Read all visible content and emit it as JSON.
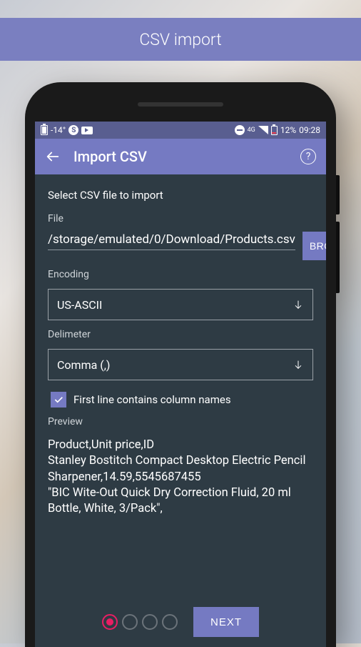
{
  "banner": {
    "title": "CSV import"
  },
  "status": {
    "temp": "-14°",
    "net_label": "4G",
    "battery_pct": "12%",
    "time": "09:28"
  },
  "appbar": {
    "title": "Import CSV"
  },
  "form": {
    "header": "Select CSV file to import",
    "file_label": "File",
    "file_path": "/storage/emulated/0/Download/Products.csv",
    "browse_label": "BROWSE...",
    "encoding_label": "Encoding",
    "encoding_value": "US-ASCII",
    "delimiter_label": "Delimeter",
    "delimiter_value": "Comma (,)",
    "firstline_label": "First line contains column names",
    "firstline_checked": true,
    "preview_label": "Preview",
    "preview_text": "Product,Unit price,ID\nStanley Bostitch Compact Desktop Electric Pencil Sharpener,14.59,5545687455\n\"BIC Wite-Out Quick Dry Correction Fluid, 20 ml Bottle, White, 3/Pack\","
  },
  "footer": {
    "page_count": 4,
    "active_page": 0,
    "next_label": "NEXT"
  }
}
